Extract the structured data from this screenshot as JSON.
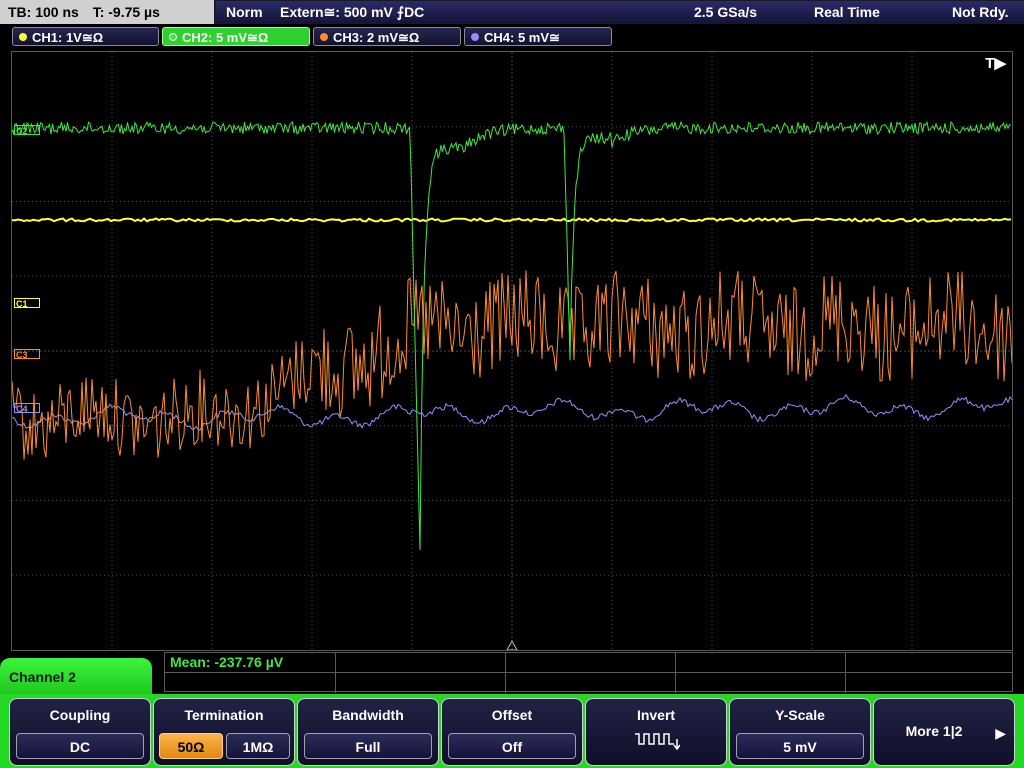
{
  "topbar": {
    "timebase": "TB: 100 ns",
    "trigger_time": "T: -9.75 µs",
    "mode": "Norm",
    "trigger": "Extern≅: 500 mV ⨍DC",
    "sample_rate": "2.5 GSa/s",
    "acq_mode": "Real Time",
    "state": "Not Rdy."
  },
  "channels": [
    {
      "label": "CH1: 1V≅Ω",
      "color": "#ffff33",
      "active": false
    },
    {
      "label": "CH2: 5 mV≅Ω",
      "color": "#3ee83e",
      "active": true
    },
    {
      "label": "CH3: 2 mV≅Ω",
      "color": "#ff8c2a",
      "active": false
    },
    {
      "label": "CH4: 5 mV≅",
      "color": "#8f8fff",
      "active": false
    }
  ],
  "grid": {
    "trigger_marker": "T▶",
    "level_markers": {
      "c1": "C1",
      "c3": "C3",
      "c4": "C4",
      "c2": "C2"
    }
  },
  "measurement": {
    "mean": "Mean: -237.76 µV"
  },
  "menu": {
    "title": "Channel 2",
    "coupling": {
      "label": "Coupling",
      "value": "DC"
    },
    "termination": {
      "label": "Termination",
      "opt_50": "50Ω",
      "opt_1m": "1MΩ"
    },
    "bandwidth": {
      "label": "Bandwidth",
      "value": "Full"
    },
    "offset": {
      "label": "Offset",
      "value": "Off"
    },
    "invert": {
      "label": "Invert"
    },
    "yscale": {
      "label": "Y-Scale",
      "value": "5 mV"
    },
    "more": {
      "label": "More 1|2",
      "arrow": "▶"
    }
  },
  "colors": {
    "ch1": "#ffff33",
    "ch2": "#3ee83e",
    "ch3": "#ff8c2a",
    "ch4": "#8f8fff",
    "grid": "#4a4a4a"
  }
}
